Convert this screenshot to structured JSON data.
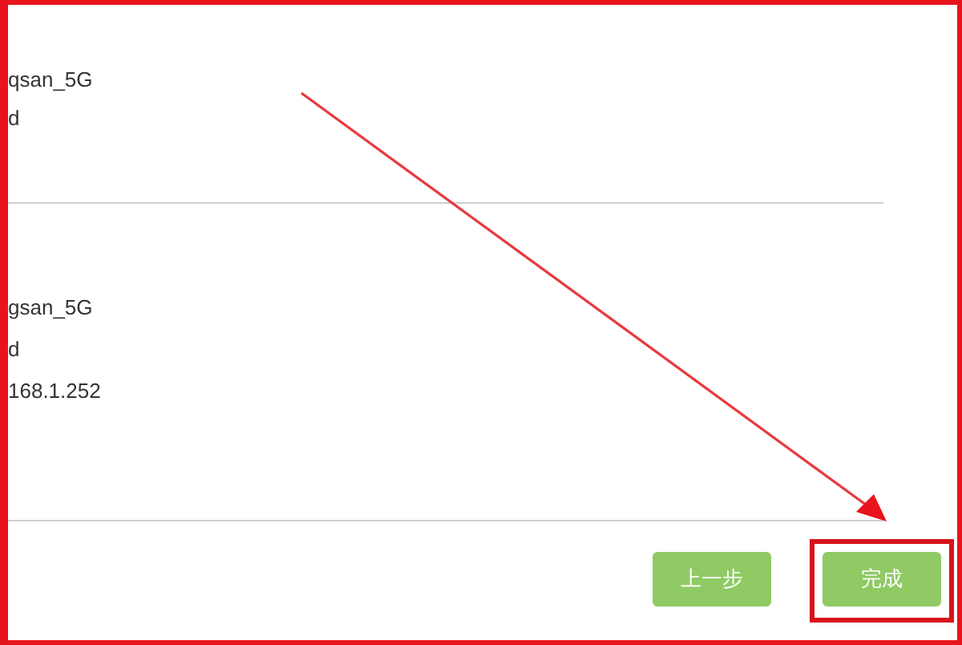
{
  "sections": [
    {
      "lines": [
        "qsan_5G",
        "d"
      ]
    },
    {
      "lines": [
        "gsan_5G",
        "d",
        "168.1.252"
      ]
    }
  ],
  "buttons": [
    {
      "label": "上一步",
      "highlighted": false
    },
    {
      "label": "完成",
      "highlighted": true
    }
  ]
}
